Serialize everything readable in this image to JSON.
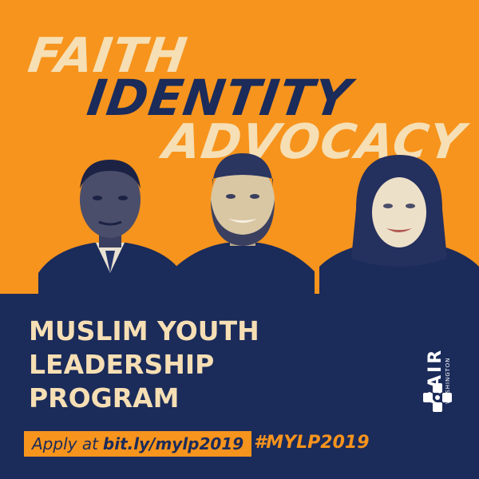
{
  "headline": {
    "line1": "FAITH",
    "line2": "IDENTITY",
    "line3": "ADVOCACY"
  },
  "colors": {
    "orange": "#f7941d",
    "navy": "#1b2b5a",
    "cream": "#f6dfb4"
  },
  "program": {
    "line1": "MUSLIM YOUTH",
    "line2": "LEADERSHIP",
    "line3": "PROGRAM"
  },
  "apply": {
    "prefix": "Apply at",
    "url": "bit.ly/mylp2019"
  },
  "hashtag": "#MYLP2019",
  "logo": {
    "name": "CAIR",
    "sub": "WASHINGTON",
    "emblem_icon": "cair-emblem-icon"
  },
  "photos": [
    "portrait-man-suit",
    "portrait-man-kufi",
    "portrait-woman-hijab"
  ]
}
